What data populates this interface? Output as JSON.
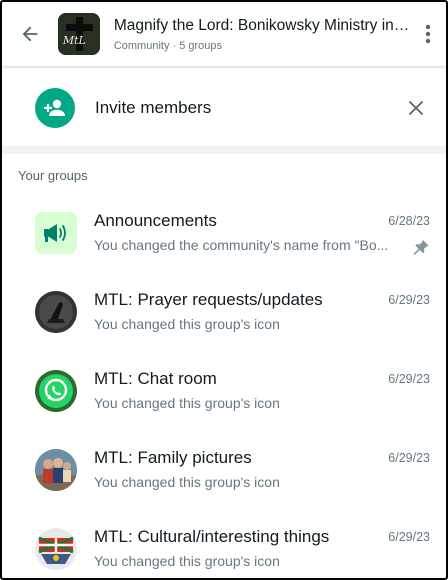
{
  "header": {
    "title": "Magnify the Lord: Bonikowsky Ministry in ...",
    "subtitle": "Community · 5 groups",
    "avatar_text": "MtL"
  },
  "invite": {
    "label": "Invite members"
  },
  "section": {
    "label": "Your groups"
  },
  "groups": [
    {
      "name": "Announcements",
      "date": "6/28/23",
      "preview": "You changed the community's name from \"Bo...",
      "pinned": true,
      "icon": "megaphone-icon"
    },
    {
      "name": "MTL: Prayer requests/updates",
      "date": "6/29/23",
      "preview": "You changed this group's icon",
      "icon": "praying-hands-icon"
    },
    {
      "name": "MTL: Chat room",
      "date": "6/29/23",
      "preview": "You changed this group's icon",
      "icon": "whatsapp-icon"
    },
    {
      "name": "MTL: Family pictures",
      "date": "6/29/23",
      "preview": "You changed this group's icon",
      "icon": "family-photo"
    },
    {
      "name": "MTL: Cultural/interesting things",
      "date": "6/29/23",
      "preview": "You changed this group's icon",
      "icon": "flag-emblem-icon"
    }
  ],
  "colors": {
    "accent": "#00a884",
    "text_primary": "#111b21",
    "text_secondary": "#667781",
    "announcement_bg": "#d9fdd3"
  }
}
